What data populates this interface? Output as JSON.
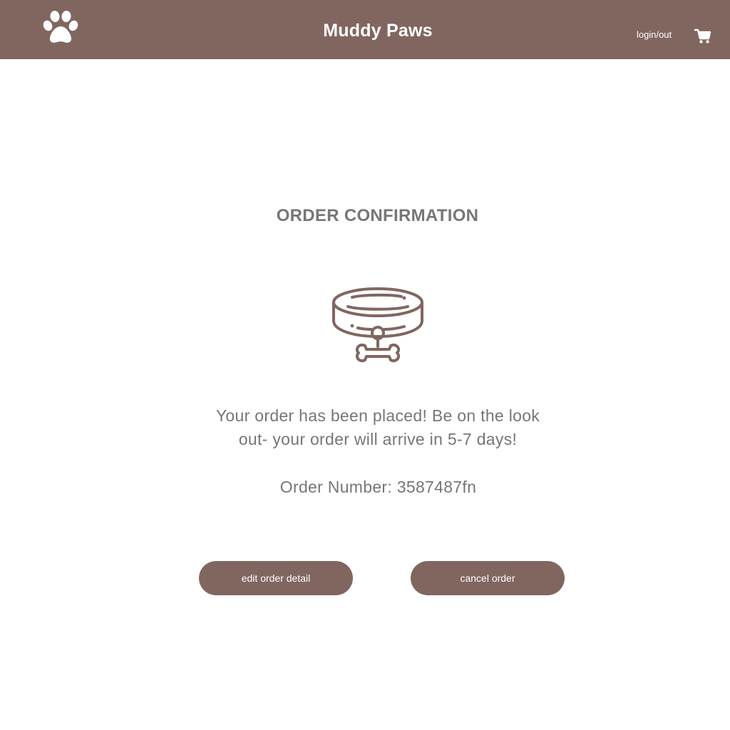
{
  "header": {
    "logo_icon": "paw-icon",
    "brand": "Muddy Paws",
    "login_label": "login/out",
    "cart_icon": "shopping-cart-icon",
    "background_color": "#816660"
  },
  "main": {
    "title": "ORDER CONFIRMATION",
    "illustration_icon": "dog-collar-icon",
    "message": "Your order has been placed! Be on the look out- your order will arrive in 5-7 days!",
    "order_number": "Order Number: 3587487fn",
    "text_color": "#767676"
  },
  "actions": {
    "edit_label": "edit order detail",
    "cancel_label": "cancel order",
    "button_color": "#816660"
  }
}
